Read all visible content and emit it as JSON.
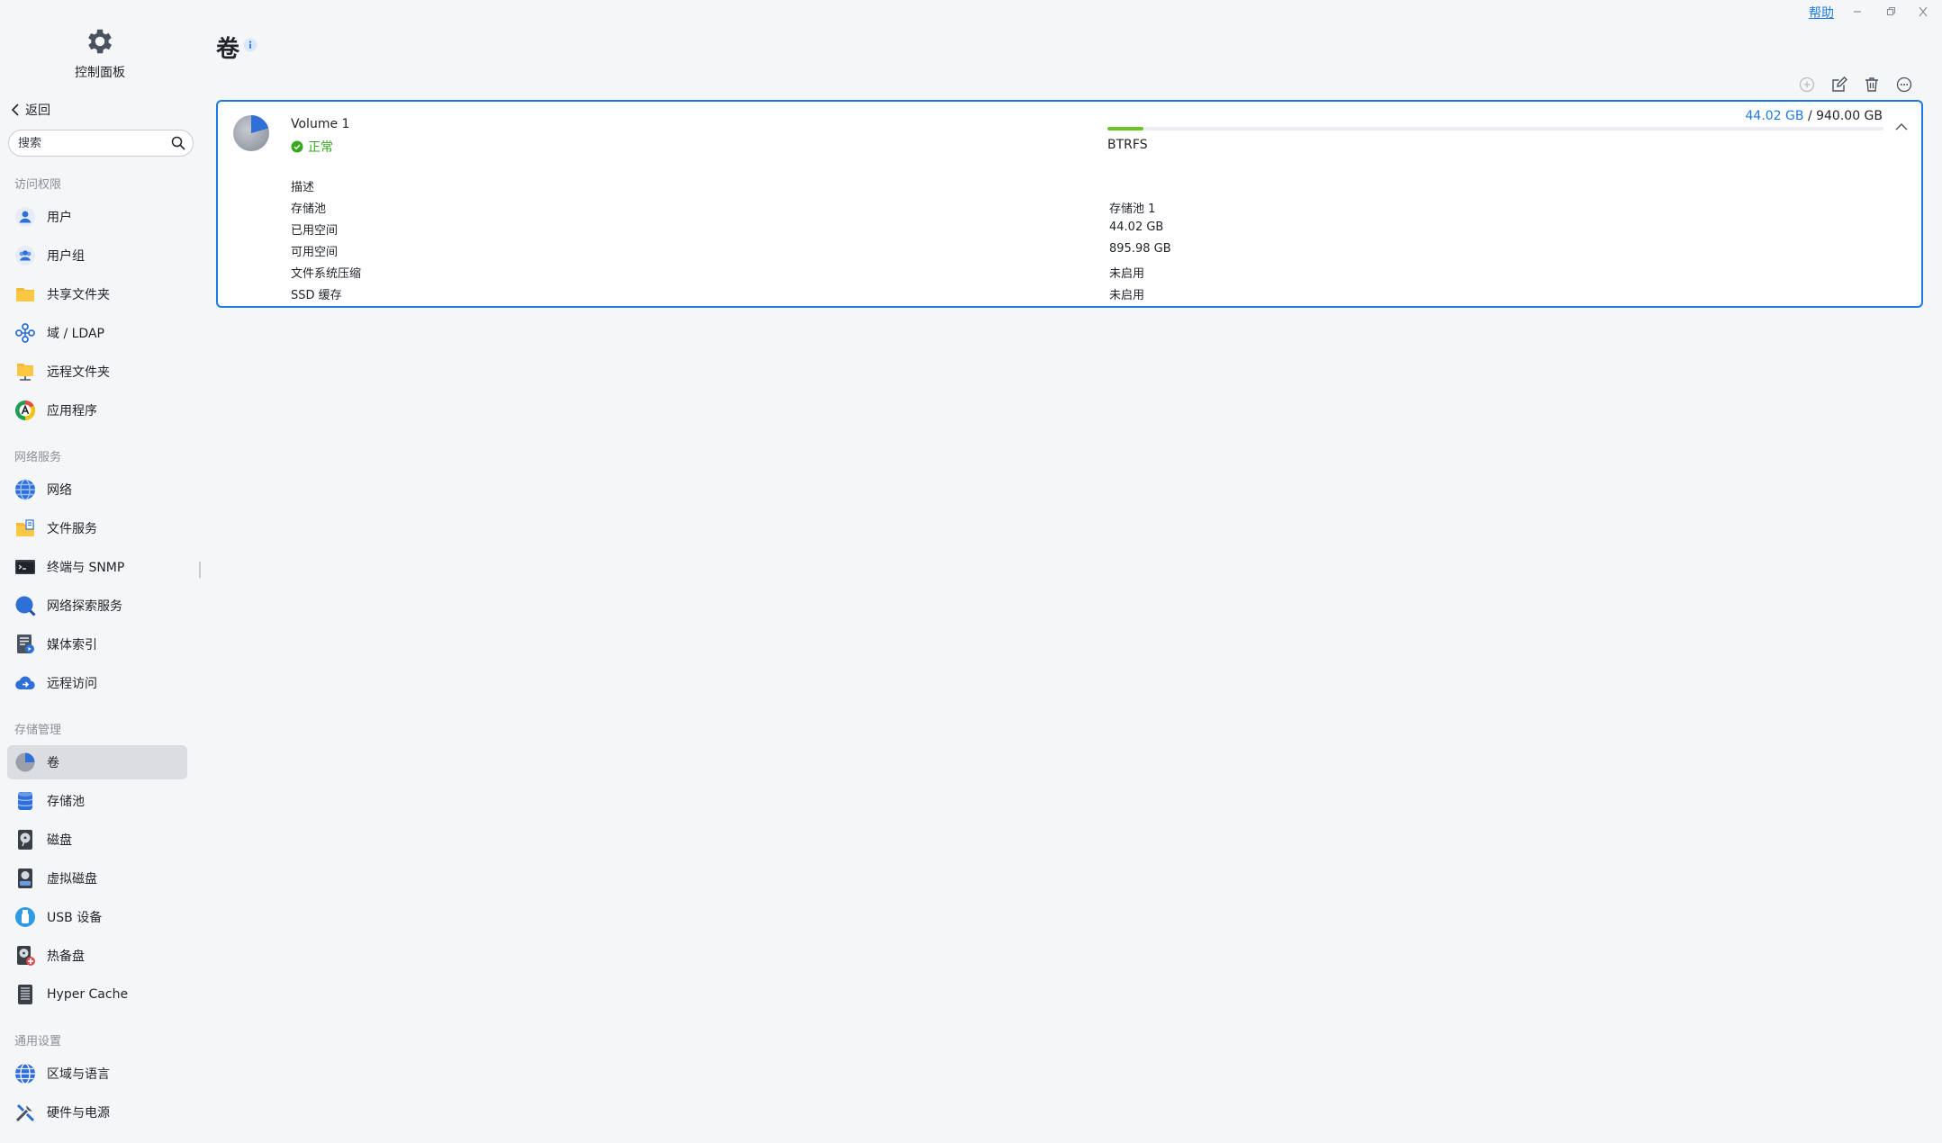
{
  "app": {
    "title": "控制面板"
  },
  "window": {
    "help_label": "帮助"
  },
  "sidebar": {
    "back_label": "返回",
    "search_placeholder": "搜索",
    "sections": [
      {
        "label": "访问权限",
        "items": [
          {
            "label": "用户",
            "icon": "user-icon"
          },
          {
            "label": "用户组",
            "icon": "user-group-icon"
          },
          {
            "label": "共享文件夹",
            "icon": "shared-folder-icon"
          },
          {
            "label": "域 / LDAP",
            "icon": "domain-ldap-icon"
          },
          {
            "label": "远程文件夹",
            "icon": "remote-folder-icon"
          },
          {
            "label": "应用程序",
            "icon": "application-icon"
          }
        ]
      },
      {
        "label": "网络服务",
        "items": [
          {
            "label": "网络",
            "icon": "network-globe-icon"
          },
          {
            "label": "文件服务",
            "icon": "file-service-icon"
          },
          {
            "label": "终端与 SNMP",
            "icon": "terminal-icon"
          },
          {
            "label": "网络探索服务",
            "icon": "network-discovery-icon"
          },
          {
            "label": "媒体索引",
            "icon": "media-index-icon"
          },
          {
            "label": "远程访问",
            "icon": "remote-access-icon"
          }
        ]
      },
      {
        "label": "存储管理",
        "items": [
          {
            "label": "卷",
            "icon": "volume-pie-icon",
            "active": true
          },
          {
            "label": "存储池",
            "icon": "storage-pool-icon"
          },
          {
            "label": "磁盘",
            "icon": "disk-icon"
          },
          {
            "label": "虚拟磁盘",
            "icon": "virtual-disk-icon"
          },
          {
            "label": "USB 设备",
            "icon": "usb-device-icon"
          },
          {
            "label": "热备盘",
            "icon": "hot-spare-icon"
          },
          {
            "label": "Hyper Cache",
            "icon": "hyper-cache-icon"
          }
        ]
      },
      {
        "label": "通用设置",
        "items": [
          {
            "label": "区域与语言",
            "icon": "region-language-icon"
          },
          {
            "label": "硬件与电源",
            "icon": "hardware-power-icon"
          }
        ]
      }
    ]
  },
  "main": {
    "title": "卷",
    "toolbar": [
      "add-icon",
      "edit-icon",
      "delete-icon",
      "more-icon"
    ],
    "volume": {
      "name": "Volume 1",
      "status": "正常",
      "used": "44.02 GB",
      "separator": "/",
      "total": "940.00 GB",
      "usage_fraction": 0.0468,
      "fs_type": "BTRFS",
      "details": [
        {
          "label": "描述",
          "value": ""
        },
        {
          "label": "存储池",
          "value": "存储池 1"
        },
        {
          "label": "已用空间",
          "value": "44.02 GB"
        },
        {
          "label": "可用空间",
          "value": "895.98 GB"
        },
        {
          "label": "文件系统压缩",
          "value": "未启用"
        },
        {
          "label": "SSD 缓存",
          "value": "未启用"
        }
      ]
    }
  },
  "colors": {
    "accent": "#1e7ae3",
    "success": "#35a81d",
    "progress": "#6cc424"
  }
}
